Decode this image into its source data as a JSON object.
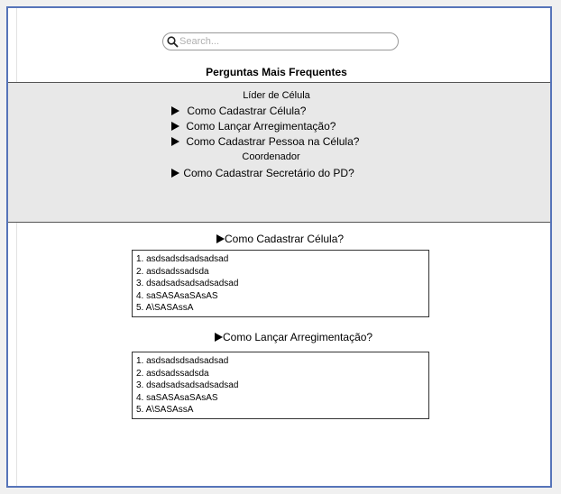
{
  "search": {
    "placeholder": "Search..."
  },
  "page_title": "Perguntas Mais Frequentes",
  "faq_index": {
    "sections": [
      {
        "heading": "Líder de Célula",
        "questions": [
          "Como Cadastrar Célula?",
          "Como Lançar Arregimentação?",
          "Como Cadastrar Pessoa na Célula?"
        ]
      },
      {
        "heading": "Coordenador",
        "questions": [
          "Como Cadastrar Secretário do PD?"
        ]
      }
    ]
  },
  "answers": [
    {
      "title": "Como Cadastrar Célula?",
      "items": [
        "1. asdsadsdsadsadsad",
        "2. asdsadssadsda",
        "3. dsadsadsadsadsadsad",
        "4. saSASAsaSAsAS",
        "5. A\\SASAssA"
      ]
    },
    {
      "title": "Como Lançar Arregimentação?",
      "items": [
        "1. asdsadsdsadsadsad",
        "2. asdsadssadsda",
        "3. dsadsadsadsadsadsad",
        "4. saSASAsaSAsAS",
        "5. A\\SASAssA"
      ]
    }
  ],
  "colors": {
    "frame_border": "#5674b9",
    "panel_bg": "#e8e8e8"
  },
  "icons": {
    "search": "magnifier-icon",
    "bullet": "triangle-right-icon"
  }
}
